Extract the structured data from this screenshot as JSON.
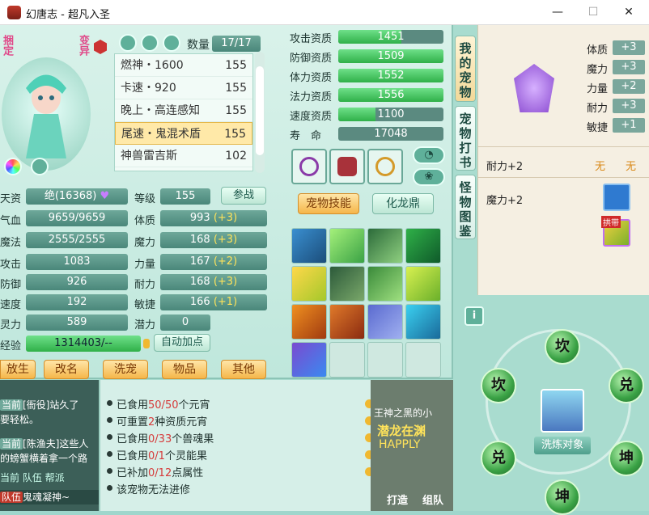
{
  "window": {
    "title": "幻唐志 - 超凡入圣",
    "minimize": "—",
    "maximize": "☐",
    "close": "✕"
  },
  "pet": {
    "tag_bound": "捆定",
    "tag_variant": "变异",
    "count_label": "数量",
    "count_value": "17/17"
  },
  "pet_list": [
    {
      "name": "燃神・1600",
      "level": "155",
      "selected": false
    },
    {
      "name": "卡速・920",
      "level": "155",
      "selected": false
    },
    {
      "name": "晚上・高连感知",
      "level": "155",
      "selected": false
    },
    {
      "name": "尾速・鬼混术盾",
      "level": "155",
      "selected": true
    },
    {
      "name": "神兽雷吉斯",
      "level": "102",
      "selected": false
    }
  ],
  "stats_left": [
    {
      "label": "天资",
      "value": "绝(16368)"
    },
    {
      "label": "气血",
      "value": "9659/9659"
    },
    {
      "label": "魔法",
      "value": "2555/2555"
    },
    {
      "label": "攻击",
      "value": "1083"
    },
    {
      "label": "防御",
      "value": "926"
    },
    {
      "label": "速度",
      "value": "192"
    },
    {
      "label": "灵力",
      "value": "589"
    }
  ],
  "stats_right": [
    {
      "label": "等级",
      "value": "155",
      "bonus": ""
    },
    {
      "label": "体质",
      "value": "993",
      "bonus": "(+3)"
    },
    {
      "label": "魔力",
      "value": "168",
      "bonus": "(+3)"
    },
    {
      "label": "力量",
      "value": "167",
      "bonus": "(+2)"
    },
    {
      "label": "耐力",
      "value": "168",
      "bonus": "(+3)"
    },
    {
      "label": "敏捷",
      "value": "166",
      "bonus": "(+1)"
    },
    {
      "label": "潜力",
      "value": "0",
      "bonus": ""
    }
  ],
  "exp": {
    "label": "经验",
    "value": "1314403/--"
  },
  "buttons": {
    "join_battle": "参战",
    "auto_points": "自动加点",
    "release": "放生",
    "rename": "改名",
    "wash": "洗宠",
    "items": "物品",
    "other": "其他",
    "pet_skills": "宠物技能",
    "transform": "化龙鼎"
  },
  "aptitudes": [
    {
      "label": "攻击资质",
      "value": "1451",
      "fill": 0.6
    },
    {
      "label": "防御资质",
      "value": "1509",
      "fill": 1.0
    },
    {
      "label": "体力资质",
      "value": "1552",
      "fill": 1.0
    },
    {
      "label": "法力资质",
      "value": "1556",
      "fill": 1.0
    },
    {
      "label": "速度资质",
      "value": "1100",
      "fill": 0.35
    },
    {
      "label": "寿　命",
      "value": "17048",
      "fill": 0
    }
  ],
  "side_tabs": [
    "我的宠物",
    "宠物打书",
    "怪物图鉴"
  ],
  "right_panel": {
    "attrs": [
      {
        "label": "体质",
        "value": "+3"
      },
      {
        "label": "魔力",
        "value": "+3"
      },
      {
        "label": "力量",
        "value": "+2"
      },
      {
        "label": "耐力",
        "value": "+3"
      },
      {
        "label": "敏捷",
        "value": "+1"
      }
    ],
    "row1_label": "耐力+2",
    "row1_col1": "无",
    "row1_col2": "无",
    "row2_label": "魔力+2",
    "item_badge": "拱带"
  },
  "food": [
    {
      "pre": "已食用",
      "red": "50/50",
      "post": "个元宵"
    },
    {
      "pre": "可重置",
      "red": "2",
      "post": "种资质元宵"
    },
    {
      "pre": "已食用",
      "red": "0/33",
      "post": "个兽魂果"
    },
    {
      "pre": "已食用",
      "red": "0/1",
      "post": "个灵能果"
    },
    {
      "pre": "已补加",
      "red": "0/12",
      "post": "点属性"
    },
    {
      "pre": "该宠物无法进修",
      "red": "",
      "post": ""
    }
  ],
  "chat": [
    {
      "tag": "当前",
      "text": "[衙役]站久了"
    },
    {
      "tag": "",
      "text": "要轻松。"
    },
    {
      "tag": "当前",
      "text": "[陈渔夫]这些人"
    },
    {
      "tag": "",
      "text": "的螃蟹横着拿一个路"
    },
    {
      "tag": "",
      "text": "当前 队伍 帮派"
    },
    {
      "tag": "队伍",
      "text": "鬼魂凝神~"
    }
  ],
  "promo": {
    "top": "王神之黑的小",
    "title": "潜龙在渊",
    "sub": "HAPPLY",
    "b1": "打造",
    "b2": "组队"
  },
  "trigram": {
    "center_label": "洗炼对象",
    "info": "i",
    "orbs": [
      "坎",
      "坎",
      "兑",
      "兑",
      "坤",
      "坤"
    ]
  }
}
